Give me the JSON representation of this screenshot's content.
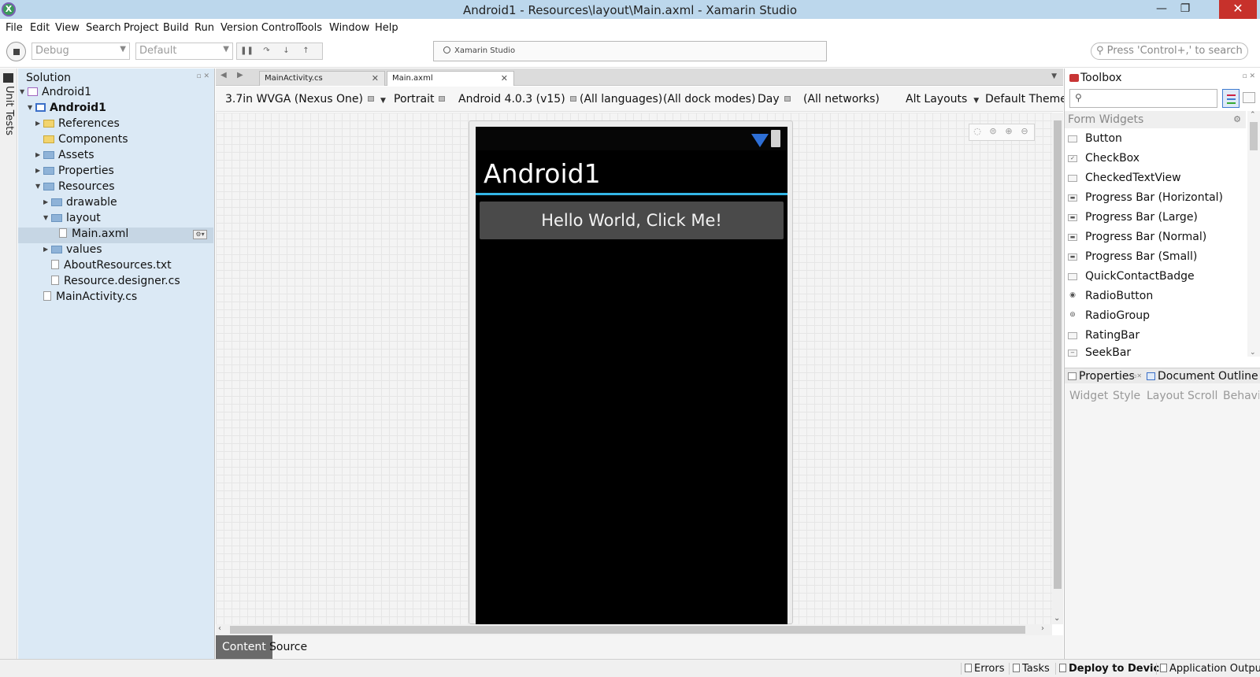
{
  "window": {
    "title": "Android1 - Resources\\layout\\Main.axml - Xamarin Studio",
    "icon_letter": "X",
    "minimize_glyph": "—",
    "maximize_glyph": "❐",
    "close_glyph": "✕"
  },
  "menu": [
    "File",
    "Edit",
    "View",
    "Search",
    "Project",
    "Build",
    "Run",
    "Version Control",
    "Tools",
    "Window",
    "Help"
  ],
  "toolbar": {
    "configuration": "Debug",
    "platform": "Default",
    "status_text": "Xamarin Studio",
    "search_placeholder": "Press 'Control+,' to search"
  },
  "left_strip": {
    "label": "Unit Tests"
  },
  "solution": {
    "title": "Solution",
    "items": [
      {
        "label": "Android1",
        "level": 0,
        "icon": "solution-icon",
        "expanded": true
      },
      {
        "label": "Android1",
        "level": 1,
        "icon": "project-icon",
        "bold": true,
        "expanded": true
      },
      {
        "label": "References",
        "level": 2,
        "icon": "folder-icon",
        "collapsed": true
      },
      {
        "label": "Components",
        "level": 2,
        "icon": "folder-icon"
      },
      {
        "label": "Assets",
        "level": 2,
        "icon": "folder-icon",
        "collapsed": true
      },
      {
        "label": "Properties",
        "level": 2,
        "icon": "folder-icon",
        "collapsed": true
      },
      {
        "label": "Resources",
        "level": 2,
        "icon": "folder-icon",
        "expanded": true
      },
      {
        "label": "drawable",
        "level": 3,
        "icon": "folder-icon",
        "collapsed": true
      },
      {
        "label": "layout",
        "level": 3,
        "icon": "folder-icon",
        "expanded": true
      },
      {
        "label": "Main.axml",
        "level": 4,
        "icon": "file-icon",
        "selected": true
      },
      {
        "label": "values",
        "level": 3,
        "icon": "folder-icon",
        "collapsed": true
      },
      {
        "label": "AboutResources.txt",
        "level": 3,
        "icon": "file-icon"
      },
      {
        "label": "Resource.designer.cs",
        "level": 3,
        "icon": "file-icon"
      },
      {
        "label": "MainActivity.cs",
        "level": 2,
        "icon": "file-icon"
      }
    ]
  },
  "doc_tabs": [
    {
      "label": "MainActivity.cs",
      "active": false
    },
    {
      "label": "Main.axml",
      "active": true
    }
  ],
  "designer": {
    "device": "3.7in WVGA (Nexus One)",
    "orientation": "Portrait",
    "api": "Android 4.0.3 (v15)",
    "languages": "(All languages)",
    "dock_modes": "(All dock modes)",
    "time": "Day",
    "networks": "(All networks)",
    "alt_layouts": "Alt Layouts",
    "theme": "Default Theme"
  },
  "phone": {
    "app_title": "Android1",
    "button_label": "Hello World, Click Me!",
    "accent_color": "#33b5e5"
  },
  "view_tabs": [
    {
      "label": "Content",
      "active": true
    },
    {
      "label": "Source",
      "active": false
    }
  ],
  "toolbox": {
    "title": "Toolbox",
    "search_value": "",
    "category": "Form Widgets",
    "items": [
      "Button",
      "CheckBox",
      "CheckedTextView",
      "Progress Bar (Horizontal)",
      "Progress Bar (Large)",
      "Progress Bar (Normal)",
      "Progress Bar (Small)",
      "QuickContactBadge",
      "RadioButton",
      "RadioGroup",
      "RatingBar",
      "SeekBar"
    ]
  },
  "properties": {
    "tab_properties": "Properties",
    "tab_outline": "Document Outline",
    "sub_tabs": [
      "Widget",
      "Style",
      "Layout",
      "Scroll",
      "Behavior"
    ]
  },
  "statusbar": [
    {
      "label": "Errors",
      "bold": false
    },
    {
      "label": "Tasks",
      "bold": false
    },
    {
      "label": "Deploy to Device",
      "bold": true
    },
    {
      "label": "Application Output",
      "bold": false
    }
  ]
}
